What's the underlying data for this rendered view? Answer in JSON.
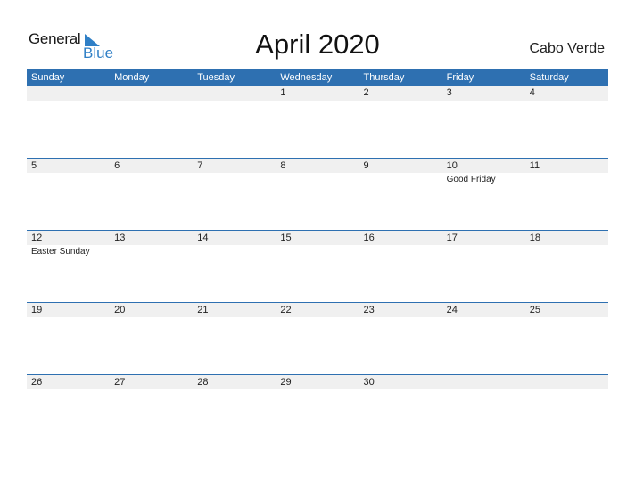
{
  "logo": {
    "line1": "General",
    "line2": "Blue",
    "icon": "triangle-flag-icon",
    "accent": "#2f7fc6"
  },
  "title": "April 2020",
  "country": "Cabo Verde",
  "colors": {
    "header_bg": "#2e70b1",
    "band_bg": "#f0f0f0"
  },
  "weekdays": [
    "Sunday",
    "Monday",
    "Tuesday",
    "Wednesday",
    "Thursday",
    "Friday",
    "Saturday"
  ],
  "weeks": [
    {
      "days": [
        {
          "num": "",
          "holiday": ""
        },
        {
          "num": "",
          "holiday": ""
        },
        {
          "num": "",
          "holiday": ""
        },
        {
          "num": "1",
          "holiday": ""
        },
        {
          "num": "2",
          "holiday": ""
        },
        {
          "num": "3",
          "holiday": ""
        },
        {
          "num": "4",
          "holiday": ""
        }
      ]
    },
    {
      "days": [
        {
          "num": "5",
          "holiday": ""
        },
        {
          "num": "6",
          "holiday": ""
        },
        {
          "num": "7",
          "holiday": ""
        },
        {
          "num": "8",
          "holiday": ""
        },
        {
          "num": "9",
          "holiday": ""
        },
        {
          "num": "10",
          "holiday": "Good Friday"
        },
        {
          "num": "11",
          "holiday": ""
        }
      ]
    },
    {
      "days": [
        {
          "num": "12",
          "holiday": "Easter Sunday"
        },
        {
          "num": "13",
          "holiday": ""
        },
        {
          "num": "14",
          "holiday": ""
        },
        {
          "num": "15",
          "holiday": ""
        },
        {
          "num": "16",
          "holiday": ""
        },
        {
          "num": "17",
          "holiday": ""
        },
        {
          "num": "18",
          "holiday": ""
        }
      ]
    },
    {
      "days": [
        {
          "num": "19",
          "holiday": ""
        },
        {
          "num": "20",
          "holiday": ""
        },
        {
          "num": "21",
          "holiday": ""
        },
        {
          "num": "22",
          "holiday": ""
        },
        {
          "num": "23",
          "holiday": ""
        },
        {
          "num": "24",
          "holiday": ""
        },
        {
          "num": "25",
          "holiday": ""
        }
      ]
    },
    {
      "days": [
        {
          "num": "26",
          "holiday": ""
        },
        {
          "num": "27",
          "holiday": ""
        },
        {
          "num": "28",
          "holiday": ""
        },
        {
          "num": "29",
          "holiday": ""
        },
        {
          "num": "30",
          "holiday": ""
        },
        {
          "num": "",
          "holiday": ""
        },
        {
          "num": "",
          "holiday": ""
        }
      ]
    }
  ]
}
